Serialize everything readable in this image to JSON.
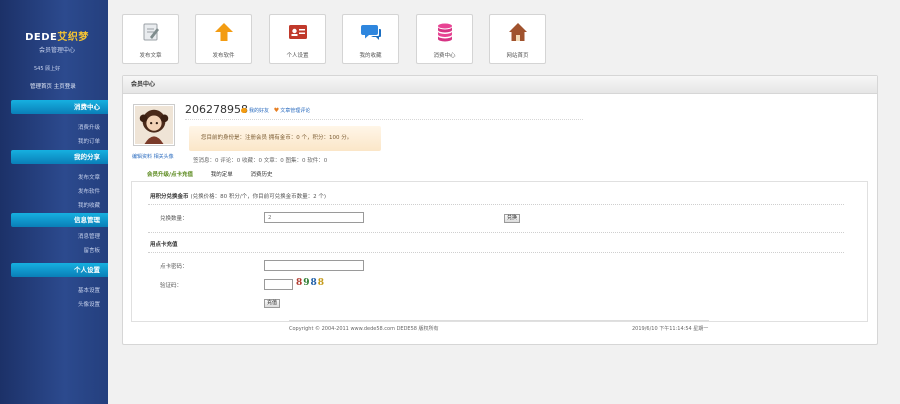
{
  "sidebar": {
    "logo_main": "DEDE",
    "logo_main_accent": "艾织梦",
    "logo_sub": "会员管理中心",
    "user_line": "545 顾上好",
    "links_line": "管理首页 主页登录",
    "sections": [
      {
        "title": "消费中心",
        "items": [
          "消费升级",
          "我的订单"
        ]
      },
      {
        "title": "我的分享",
        "items": [
          "发布文章",
          "发布软件",
          "我的收藏"
        ]
      },
      {
        "title": "信息管理",
        "items": [
          "消息管理",
          "留言板"
        ]
      },
      {
        "title": "个人设置",
        "items": [
          "基本设置",
          "头像设置"
        ]
      }
    ]
  },
  "toolbar": {
    "buttons": [
      {
        "label": "发布文章",
        "icon": "document-pen-icon",
        "color": "#9aa0a6"
      },
      {
        "label": "发布软件",
        "icon": "upload-arrow-icon",
        "color": "#f39c12"
      },
      {
        "label": "个人设置",
        "icon": "id-card-icon",
        "color": "#c0392b"
      },
      {
        "label": "我的收藏",
        "icon": "chat-bubble-icon",
        "color": "#2e86de"
      },
      {
        "label": "消费中心",
        "icon": "database-icon",
        "color": "#e84393"
      },
      {
        "label": "网站首页",
        "icon": "home-icon",
        "color": "#a0522d"
      }
    ]
  },
  "panel": {
    "title": "会员中心",
    "profile": {
      "username": "206278958",
      "link_friends": "我的好友",
      "link_articles": "文章管理评论",
      "avatar_links": "编辑资料 相关头像",
      "status_text": "您目前的身份是：注册会员 拥有金币：0 个，积分：100 分。",
      "stats_text": "签消息：0 评论：0 收藏：0 文章：0 图集：0 软件：0"
    },
    "tabs": [
      {
        "label": "会员升级/点卡充值",
        "active": true
      },
      {
        "label": "我的定单",
        "active": false
      },
      {
        "label": "消费历史",
        "active": false
      }
    ],
    "exchange": {
      "title": "用积分兑换金币",
      "note": "(兑换价格：80 积分/个，你目前可兑换金币数量：2 个)",
      "quantity_label": "兑换数量：",
      "quantity_value": "2",
      "submit_label": "兑换"
    },
    "recharge": {
      "title": "用点卡充值",
      "card_label": "点卡密码：",
      "card_value": "",
      "captcha_label": "验证码：",
      "captcha_value": "",
      "captcha_digits": [
        "8",
        "9",
        "8",
        "8"
      ],
      "captcha_colors": [
        "#b03a2e",
        "#2e7d32",
        "#1f5fa8",
        "#c49a1a"
      ],
      "submit_label": "充值"
    },
    "footer": {
      "copyright": "Copyright © 2004-2011 www.dede58.com DEDE58 版权所有",
      "datetime": "2019/6/10 下午11:14:54 星期一"
    }
  }
}
